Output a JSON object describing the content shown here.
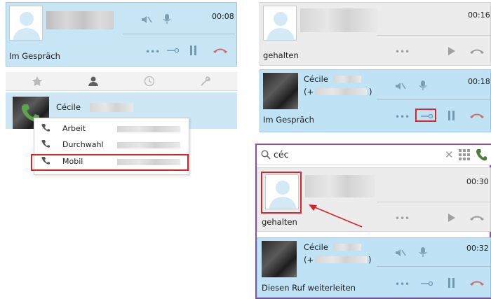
{
  "left": {
    "active_call": {
      "status": "Im Gespräch",
      "time": "00:08",
      "controls": [
        "mute-icon",
        "microphone-icon",
        "more-icon",
        "transfer-icon",
        "pause-icon",
        "hangup-icon"
      ]
    },
    "tabs": [
      {
        "icon": "star-icon"
      },
      {
        "icon": "person-icon"
      },
      {
        "icon": "clock-icon"
      },
      {
        "icon": "wrench-icon"
      }
    ],
    "contact": {
      "name": "Cécile",
      "menu": [
        {
          "label": "Arbeit"
        },
        {
          "label": "Durchwahl"
        },
        {
          "label": "Mobil"
        }
      ]
    }
  },
  "right": {
    "held_call": {
      "status": "gehalten",
      "time": "00:16"
    },
    "active_call": {
      "name": "Cécile",
      "number_prefix": "(+",
      "number_suffix": ")",
      "status": "Im Gespräch",
      "time": "00:18"
    },
    "search": {
      "value": "céc"
    },
    "held_call2": {
      "status": "gehalten",
      "time": "00:30"
    },
    "forward_call": {
      "name": "Cécile",
      "number_prefix": "(+",
      "number_suffix": ")",
      "status": "Diesen Ruf weiterleiten",
      "time": "00:32"
    }
  },
  "colors": {
    "highlight": "#d9232a",
    "panel_blue": "#c7e5f5",
    "panel_grey": "#ececec",
    "frame_purple": "#8a4f9e"
  }
}
